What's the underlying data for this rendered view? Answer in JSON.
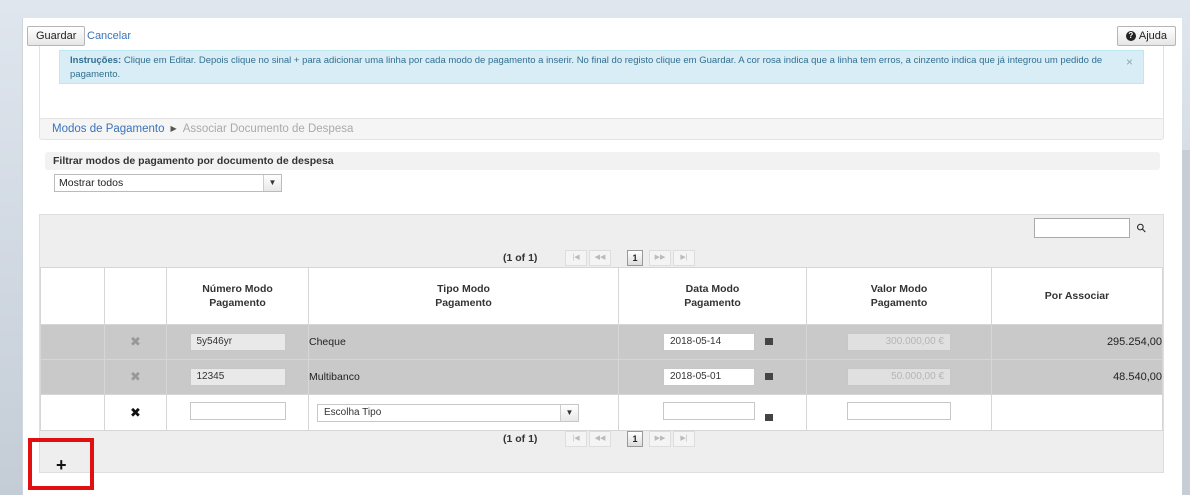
{
  "toolbar": {
    "save_label": "Guardar",
    "cancel_label": "Cancelar",
    "help_label": "Ajuda"
  },
  "instructions": {
    "label": "Instruções:",
    "text": " Clique em Editar. Depois clique no sinal + para adicionar uma linha por cada modo de pagamento a inserir. No final do registo clique em Guardar. A cor rosa indica que a linha tem erros, a cinzento indica que já integrou um pedido de pagamento.",
    "close": "×"
  },
  "breadcrumb": {
    "link": "Modos de Pagamento",
    "current": "Associar Documento de Despesa"
  },
  "filter": {
    "label": "Filtrar modos de pagamento por documento de despesa",
    "selected": "Mostrar todos"
  },
  "pager": {
    "text": "(1 of 1)",
    "page": "1"
  },
  "table": {
    "headers": {
      "numero": "Número Modo\nPagamento",
      "tipo": "Tipo Modo\nPagamento",
      "data": "Data Modo\nPagamento",
      "valor": "Valor Modo\nPagamento",
      "por": "Por Associar"
    },
    "rows": [
      {
        "numero": "5y546yr",
        "tipo": "Cheque",
        "data": "2018-05-14",
        "valor": "300.000,00 €",
        "por": "295.254,00"
      },
      {
        "numero": "12345",
        "tipo": "Multibanco",
        "data": "2018-05-01",
        "valor": "50.000,00 €",
        "por": "48.540,00"
      }
    ],
    "new_row": {
      "tipo_placeholder": "Escolha Tipo"
    }
  },
  "icons": {
    "delete": "delete-icon",
    "calendar": "calendar-icon",
    "add": "plus-icon",
    "search": "search-icon",
    "help": "help-icon"
  },
  "colors": {
    "info_bg": "#d9edf7",
    "integrated_row": "#c9c9c9",
    "highlight": "#e01010",
    "link": "#3b73b9"
  }
}
